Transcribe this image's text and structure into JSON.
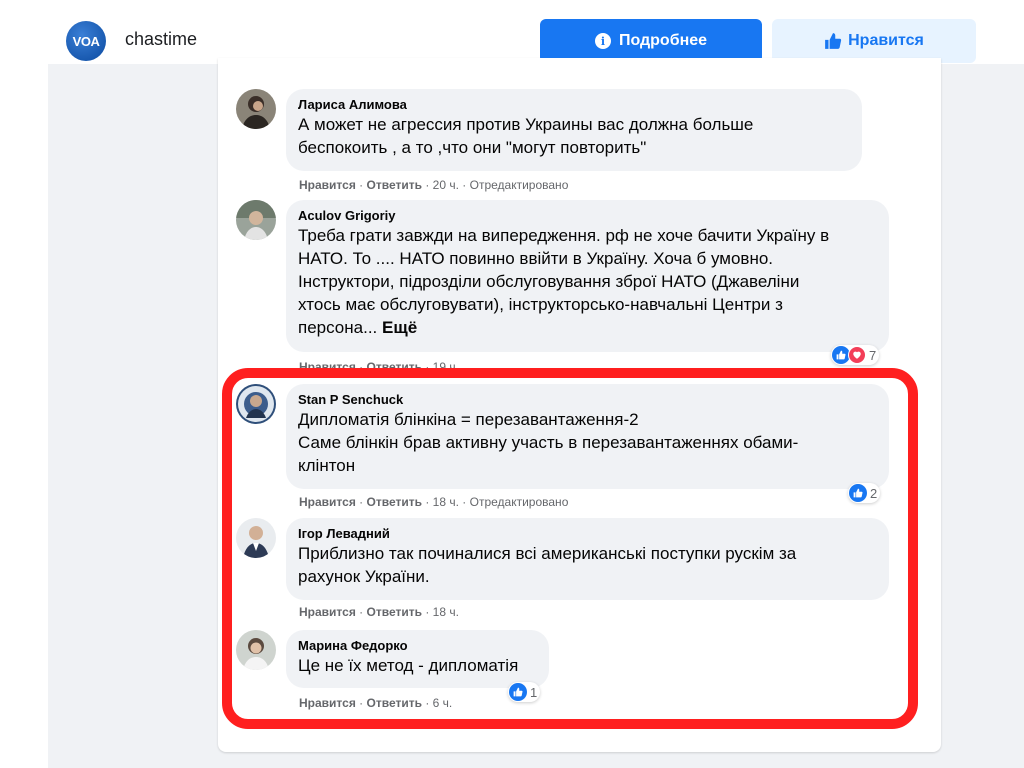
{
  "header": {
    "logo_text": "VOA",
    "page_name": "chastime",
    "more_button": "Подробнее",
    "like_button": "Нравится",
    "accent": "#1877f2"
  },
  "actions": {
    "like": "Нравится",
    "reply": "Ответить",
    "separator": "·",
    "edited": "Отредактировано"
  },
  "comments": [
    {
      "author": "Лариса Алимова",
      "lines": [
        "А может не агрессия против Украины вас должна больше",
        "беспокоить , а то ,что они \"могут повторить\""
      ],
      "time": "20 ч.",
      "edited": true
    },
    {
      "author": "Aculov Grigoriy",
      "lines": [
        "Треба грати завжди на випередження. рф не хоче бачити Україну в",
        "НАТО. То .... НАТО повинно ввійти в Україну. Хоча б умовно.",
        "Інструктори, підрозділи обслуговування зброї НАТО (Джавеліни",
        "хтось має обслуговувати), інструкторсько-навчальні Центри з",
        "персона..."
      ],
      "more": "Ещё",
      "reactions": "7",
      "time": "19 ч."
    },
    {
      "author": "Stan P Senchuck",
      "lines": [
        "Дипломатія блінкіна = перезавантаження-2",
        "Саме блінкін брав активну участь в перезавантаженнях обами-",
        "клінтон"
      ],
      "reactions": "2",
      "time": "18 ч.",
      "edited": true
    },
    {
      "author": "Ігор Левадний",
      "lines": [
        "Приблизно так починалися всі американські поступки рускім за",
        "рахунок України."
      ],
      "time": "18 ч."
    },
    {
      "author": "Марина Федорко",
      "lines": [
        "Це не їх метод - дипломатія"
      ],
      "reactions": "1",
      "time": "6 ч."
    }
  ],
  "highlight_color": "#ff1f1f"
}
